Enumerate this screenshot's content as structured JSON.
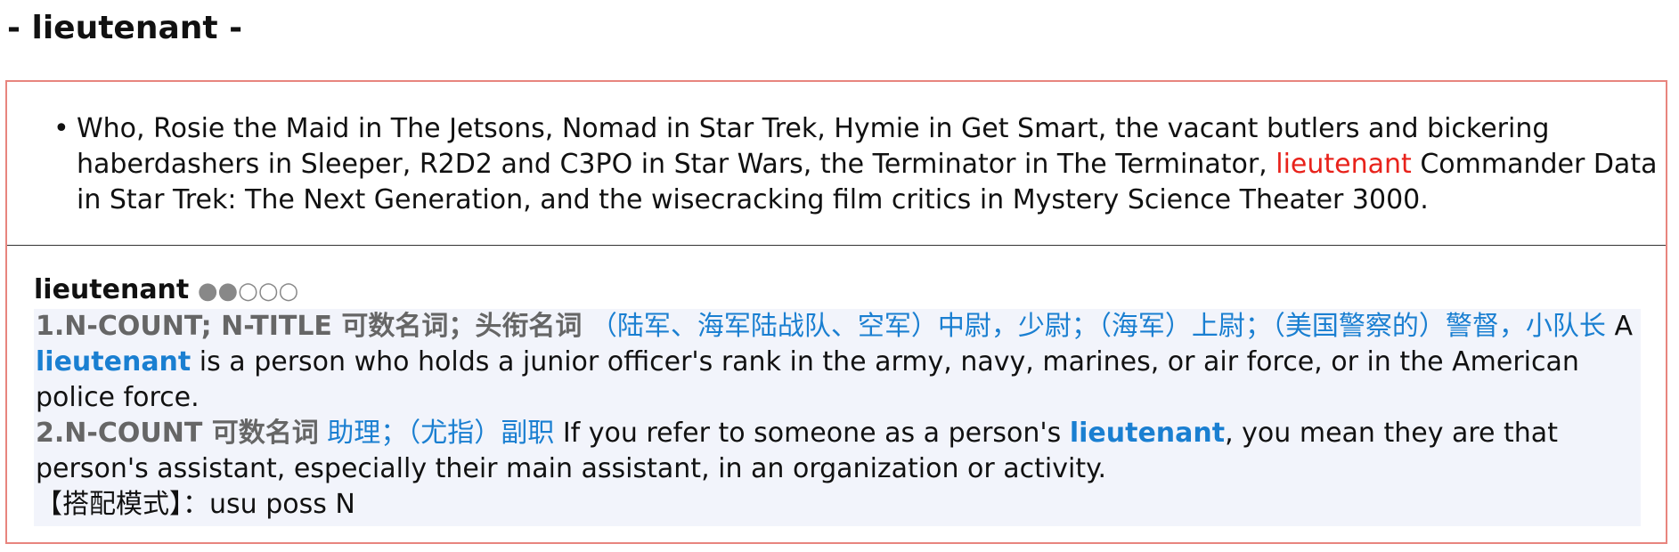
{
  "heading": "- lieutenant -",
  "example": {
    "before": "Who, Rosie the Maid in The Jetsons, Nomad in Star Trek, Hymie in Get Smart, the vacant butlers and bickering haberdashers in Sleeper, R2D2 and C3PO in Star Wars, the Terminator in The Terminator, ",
    "highlight": "lieutenant",
    "after": " Commander Data in Star Trek: The Next Generation, and the wisecracking film critics in Mystery Science Theater 3000."
  },
  "entry": {
    "word": "lieutenant",
    "frequency_dots": "●●○○○",
    "senses": [
      {
        "label": "1.N-COUNT; N-TITLE 可数名词；头衔名词",
        "chinese": "（陆军、海军陆战队、空军）中尉，少尉；（海军）上尉；（美国警察的）警督，小队长",
        "text_before": " A ",
        "keyword": "lieutenant",
        "text_after": " is a person who holds a junior officer's rank in the army, navy, marines, or air force, or in the American police force."
      },
      {
        "label": "2.N-COUNT 可数名词",
        "chinese": "助理；（尤指）副职",
        "text_before": " If you refer to someone as a person's ",
        "keyword": "lieutenant",
        "text_after": ", you mean they are that person's assistant, especially their main assistant, in an organization or activity."
      }
    ],
    "pattern": "【搭配模式】：usu poss N"
  },
  "colors": {
    "border": "#e8857e",
    "highlight_red": "#e8221b",
    "highlight_blue": "#1a7fd1",
    "label_gray": "#666666",
    "defs_background": "#f2f4fb"
  }
}
